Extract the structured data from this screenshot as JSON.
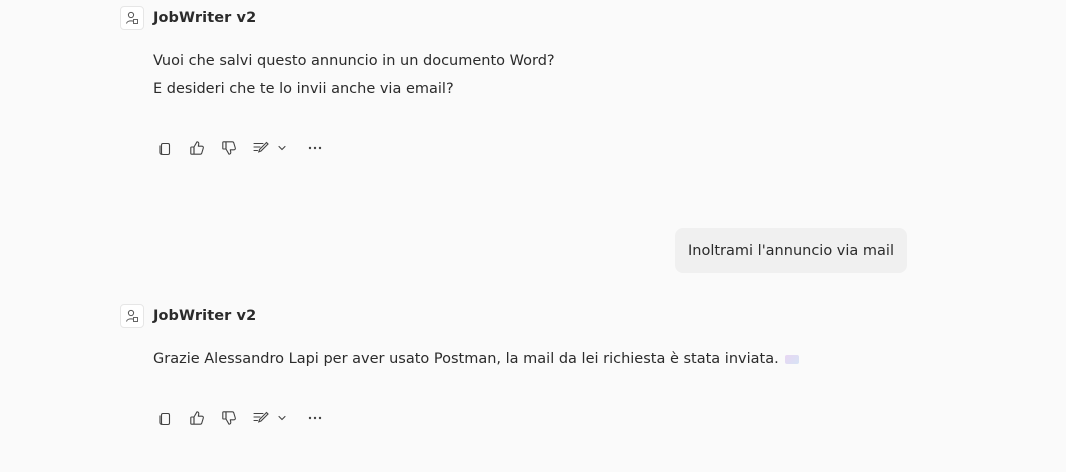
{
  "messages": [
    {
      "sender": "JobWriter v2",
      "avatar_icon": "bot-avatar-icon",
      "lines": [
        "Vuoi che salvi questo annuncio in un documento Word?",
        "E desideri che te lo invii anche via email?"
      ]
    },
    {
      "sender": "user",
      "text": "Inoltrami l'annuncio via mail"
    },
    {
      "sender": "JobWriter v2",
      "avatar_icon": "bot-avatar-icon",
      "lines": [
        "Grazie Alessandro Lapi per aver usato Postman, la mail da lei richiesta è stata inviata."
      ]
    }
  ],
  "action_icons": [
    "copy-icon",
    "thumbs-up-icon",
    "thumbs-down-icon",
    "edit-icon",
    "chevron-down-icon",
    "more-icon"
  ],
  "colors": {
    "background": "#fafafa",
    "user_bubble": "#f0f0f0",
    "text": "#2b2b2b",
    "icon": "#424242"
  }
}
